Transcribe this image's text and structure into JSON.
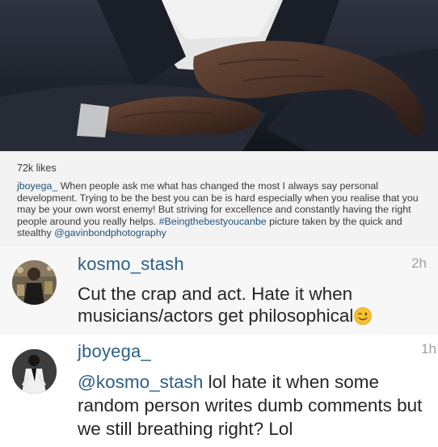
{
  "post": {
    "likes": "72k likes",
    "caption_user": "jboyega_",
    "caption_body": " When people ask me what has changed the most I always say personal development. Trying to be the best you can be is hard especially when you realise that you may be your own worst enemy! But striving for excellence and constantly having the right people around you really helps. ",
    "caption_hashtag": "#Beingthebestyoucanbe",
    "caption_mid": " picture taken by the quick and stealthy ",
    "caption_mention": "@gavinbondphotography"
  },
  "comments": [
    {
      "username": "kosmo_stash",
      "time": "2h",
      "text": "Cut the crap and act. Hate it when musicians/actors get philosophical",
      "emoji": "winking-face"
    },
    {
      "username": "jboyega_",
      "time": "1h",
      "mention": "@kosmo_stash",
      "text": " lol hate it when some random person writes dumb comments but we still breathing right? Lol"
    }
  ],
  "colors": {
    "link": "#2b5f86",
    "caption_bg": "#f3f3f3",
    "timestamp": "#a0a0a0"
  }
}
